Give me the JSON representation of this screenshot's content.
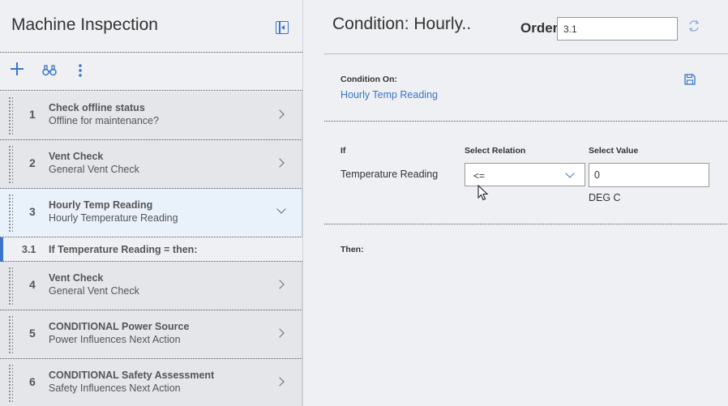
{
  "left_panel": {
    "title": "Machine Inspection",
    "items": [
      {
        "num": "1",
        "title": "Check offline status",
        "subtitle": "Offline for maintenance?"
      },
      {
        "num": "2",
        "title": "Vent Check",
        "subtitle": "General Vent Check"
      },
      {
        "num": "3",
        "title": "Hourly Temp Reading",
        "subtitle": "Hourly Temperature Reading"
      },
      {
        "num": "3.1",
        "title": "If Temperature Reading = then:"
      },
      {
        "num": "4",
        "title": "Vent Check",
        "subtitle": "General Vent Check"
      },
      {
        "num": "5",
        "title": "CONDITIONAL Power Source",
        "subtitle": "Power Influences Next Action"
      },
      {
        "num": "6",
        "title": "CONDITIONAL Safety Assessment",
        "subtitle": "Safety Influences Next Action"
      }
    ],
    "toolbar_icons": [
      "plus-icon",
      "binoculars-icon",
      "more-vertical-icon"
    ]
  },
  "right_panel": {
    "title": "Condition: Hourly..",
    "order_label": "Order",
    "order_value": "3.1",
    "condition_on_label": "Condition On:",
    "condition_on_value": "Hourly Temp Reading",
    "if_label": "If",
    "select_relation_label": "Select Relation",
    "select_value_label": "Select Value",
    "field_name": "Temperature Reading",
    "relation_value": "<=",
    "value": "0",
    "unit": "DEG C",
    "then_label": "Then:"
  },
  "colors": {
    "accent": "#3b74c9",
    "active_row": "#e9f1fb",
    "row": "#e4e6ea",
    "background": "#eef0f3"
  }
}
